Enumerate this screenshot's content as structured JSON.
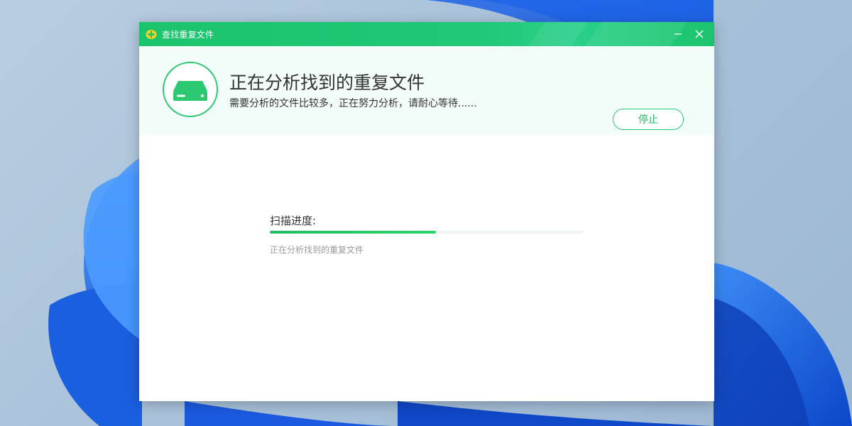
{
  "window": {
    "title": "查找重复文件"
  },
  "header": {
    "headline": "正在分析找到的重复文件",
    "subline": "需要分析的文件比较多，正在努力分析，请耐心等待......",
    "stop_label": "停止",
    "icon": "hard-disk-icon"
  },
  "progress": {
    "label": "扫描进度:",
    "value": 0.53,
    "status": "正在分析找到的重复文件"
  },
  "colors": {
    "accent": "#1bc46c",
    "header_bg": "#f2fcf8",
    "desktop_bloom": "#1a63e0"
  }
}
